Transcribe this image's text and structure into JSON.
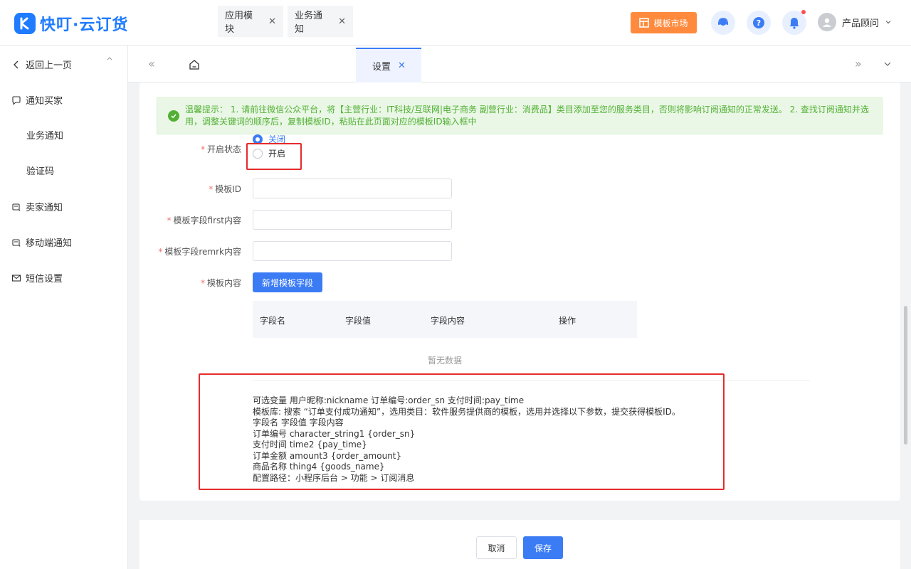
{
  "app": {
    "name": "快叮·云订货"
  },
  "header": {
    "market_label": "模板市场",
    "user_name": "产品顾问"
  },
  "sidebar": {
    "back_label": "返回上一页",
    "items": [
      {
        "label": "通知买家"
      },
      {
        "label": "业务通知"
      },
      {
        "label": "验证码"
      },
      {
        "label": "卖家通知"
      },
      {
        "label": "移动端通知"
      },
      {
        "label": "短信设置"
      }
    ]
  },
  "tabs": [
    {
      "label": "应用模块"
    },
    {
      "label": "业务通知"
    },
    {
      "label": "设置"
    }
  ],
  "notice": "温馨提示： 1. 请前往微信公众平台，将【主营行业：IT科技/互联网|电子商务 副营行业：消费品】类目添加至您的服务类目，否则将影响订阅通知的正常发送。 2. 查找订阅通知并选用，调整关键词的顺序后，复制模板ID，粘贴在此页面对应的模板ID输入框中",
  "form": {
    "status_label": "开启状态",
    "status_options": [
      "关闭",
      "开启"
    ],
    "status_selected": "关闭",
    "template_id_label": "模板ID",
    "first_label": "模板字段first内容",
    "remark_label": "模板字段remrk内容",
    "content_label": "模板内容",
    "add_field_button": "新增模板字段",
    "table_headers": [
      "字段名",
      "字段值",
      "字段内容",
      "操作"
    ],
    "empty_text": "暂无数据"
  },
  "tips": [
    "可选变量 用户昵称:nickname 订单编号:order_sn 支付时间:pay_time",
    "模板库: 搜索 “订单支付成功通知”，选用类目：软件服务提供商的模板，选用并选择以下参数，提交获得模板ID。",
    "字段名 字段值 字段内容",
    "订单编号 character_string1 {order_sn}",
    "支付时间 time2 {pay_time}",
    "订单金额 amount3 {order_amount}",
    "商品名称 thing4 {goods_name}",
    "配置路径：小程序后台 > 功能 > 订阅消息"
  ],
  "footer": {
    "cancel": "取消",
    "save": "保存"
  },
  "colors": {
    "primary": "#3b7cf5",
    "brand": "#1f7bff",
    "market": "#ff8a3d",
    "notice_text": "#52b035",
    "highlight_box": "#e52b2b"
  }
}
